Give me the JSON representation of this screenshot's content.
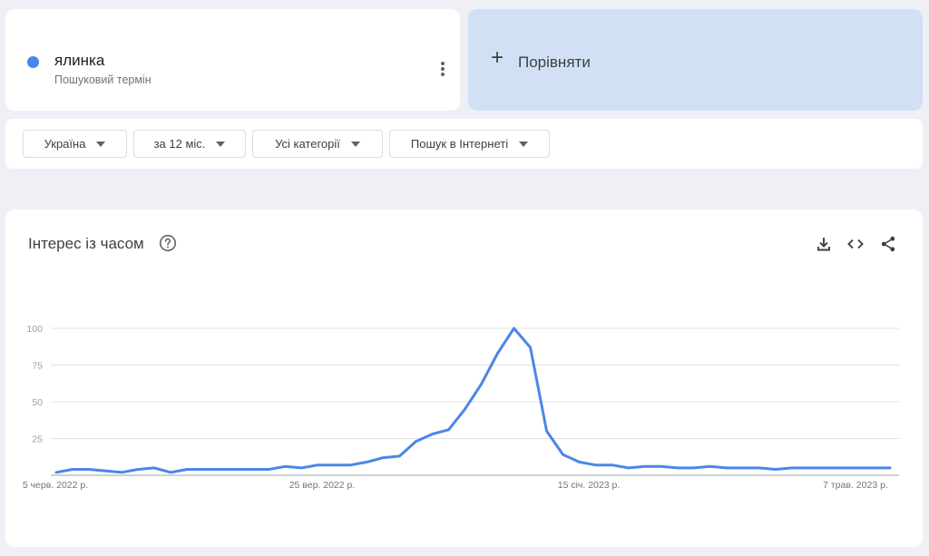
{
  "term": {
    "name": "ялинка",
    "subtitle": "Пошуковий термін",
    "color": "#4a86e8"
  },
  "compare": {
    "label": "Порівняти"
  },
  "filters": [
    {
      "label": "Україна"
    },
    {
      "label": "за 12 міс."
    },
    {
      "label": "Усі категорії"
    },
    {
      "label": "Пошук в Інтернеті"
    }
  ],
  "chart": {
    "title": "Інтерес із часом",
    "icons": [
      "help-icon",
      "download-icon",
      "embed-icon",
      "share-icon"
    ]
  },
  "chart_data": {
    "type": "line",
    "title": "Інтерес із часом",
    "xlabel": "",
    "ylabel": "",
    "ylim": [
      0,
      100
    ],
    "y_ticks": [
      100,
      75,
      50,
      25
    ],
    "x_ticks": [
      "5 черв. 2022 р.",
      "25 вер. 2022 р.",
      "15 січ. 2023 р.",
      "7 трав. 2023 р."
    ],
    "grid": true,
    "line_color": "#4a86e8",
    "series": [
      {
        "values": [
          2,
          4,
          4,
          3,
          2,
          4,
          5,
          2,
          4,
          4,
          4,
          4,
          4,
          4,
          6,
          5,
          7,
          7,
          7,
          9,
          12,
          13,
          23,
          28,
          31,
          45,
          62,
          83,
          100,
          87,
          30,
          14,
          9,
          7,
          7,
          5,
          6,
          6,
          5,
          5,
          6,
          5,
          5,
          5,
          4,
          5,
          5,
          5,
          5,
          5,
          5,
          5
        ]
      }
    ]
  }
}
